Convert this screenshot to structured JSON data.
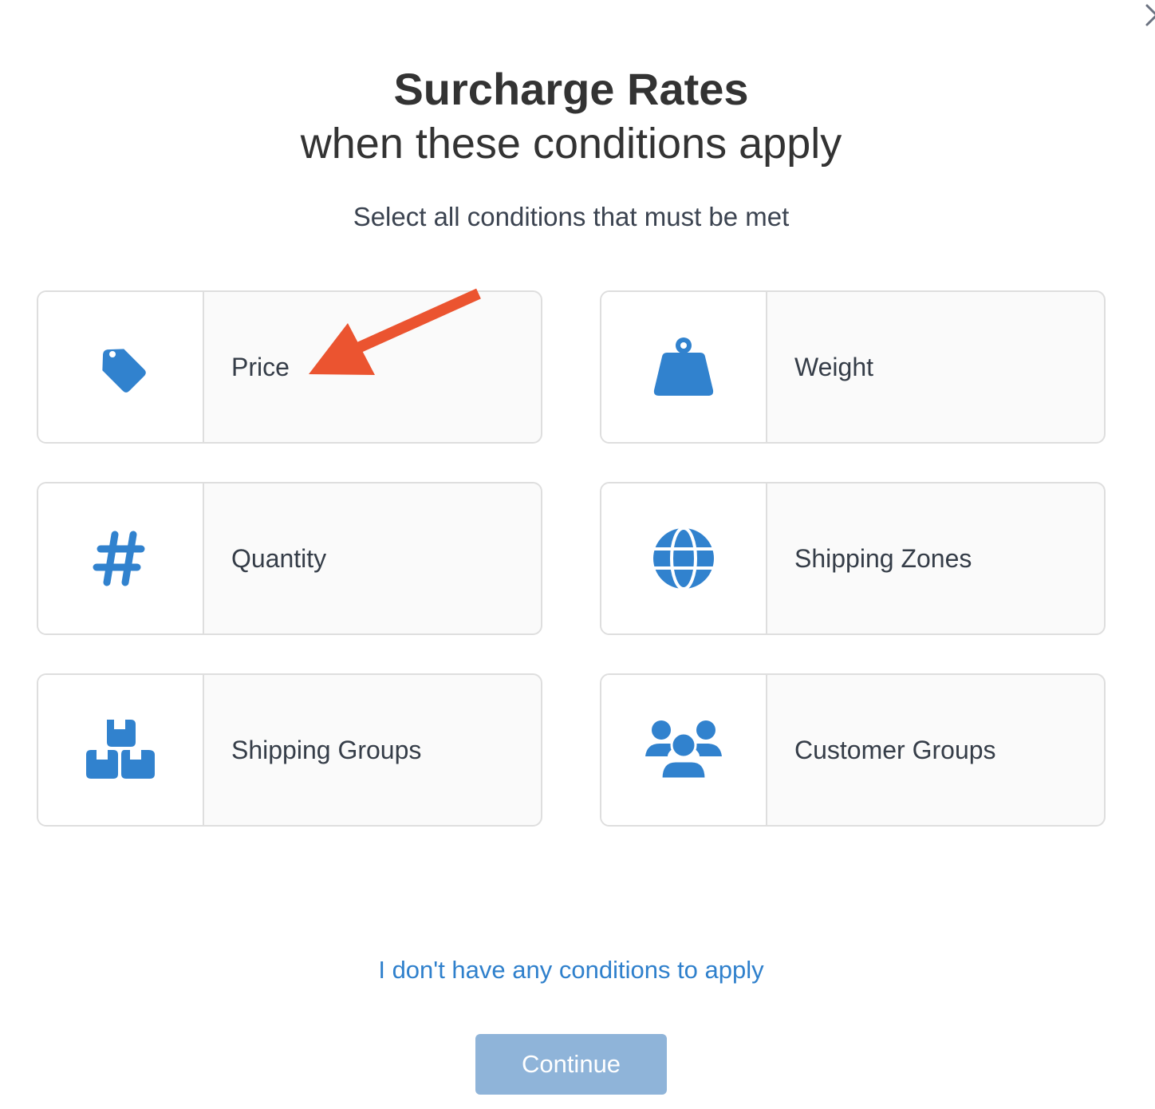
{
  "dialog": {
    "close_icon": "close-icon",
    "title": "Surcharge Rates",
    "subtitle": "when these conditions apply",
    "instruction": "Select all conditions that must be met"
  },
  "conditions": [
    {
      "label": "Price",
      "icon": "price-tag-icon"
    },
    {
      "label": "Weight",
      "icon": "weight-icon"
    },
    {
      "label": "Quantity",
      "icon": "hashtag-icon"
    },
    {
      "label": "Shipping Zones",
      "icon": "globe-icon"
    },
    {
      "label": "Shipping Groups",
      "icon": "boxes-icon"
    },
    {
      "label": "Customer Groups",
      "icon": "users-icon"
    }
  ],
  "footer": {
    "no_conditions_link": "I don't have any conditions to apply",
    "continue_label": "Continue"
  },
  "annotation": {
    "type": "arrow",
    "points_to": "Price",
    "color": "#EB5430"
  },
  "colors": {
    "icon_blue": "#3182CE",
    "link_blue": "#2F80CC",
    "continue_disabled": "#8FB4D9",
    "card_border": "#DEDEDE",
    "card_bg": "#FAFAFA",
    "title_text": "#333333"
  }
}
